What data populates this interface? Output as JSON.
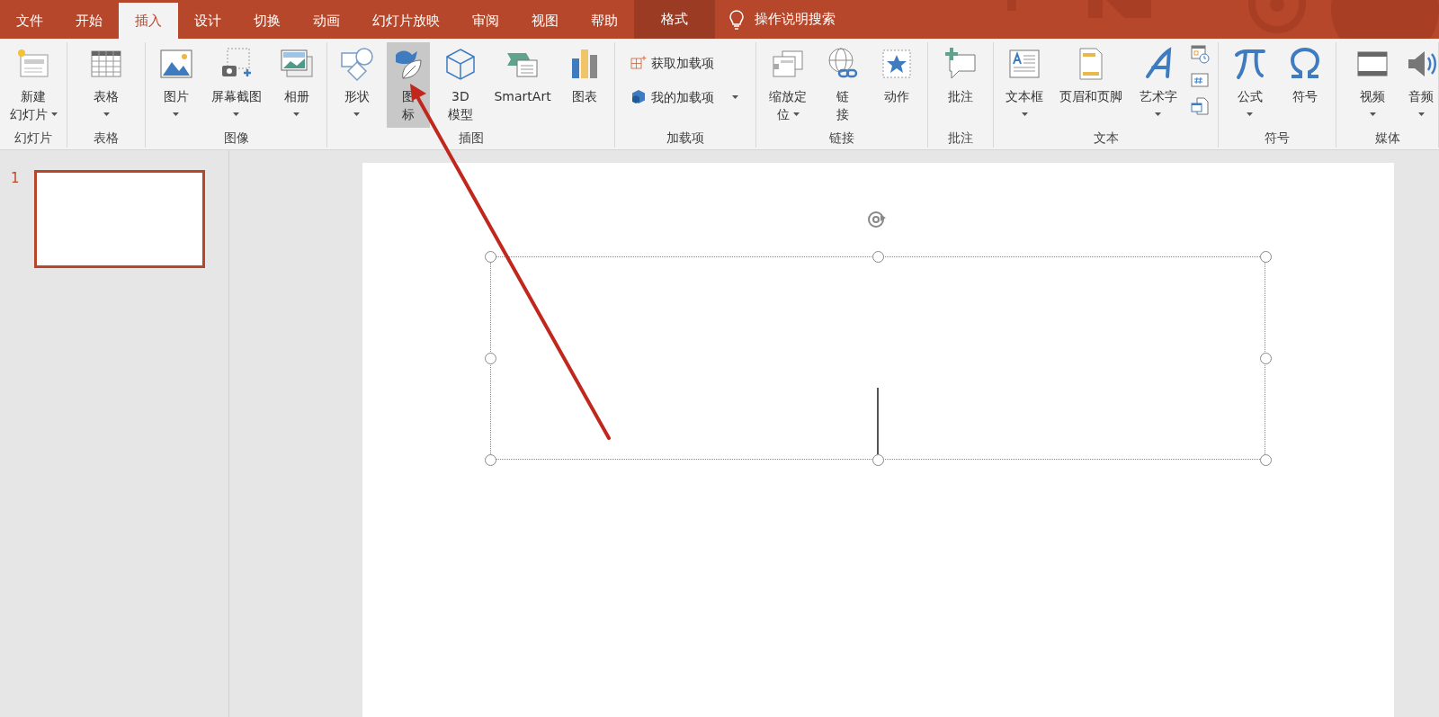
{
  "tabs": [
    {
      "label": "文件",
      "selected": false,
      "contextual": false
    },
    {
      "label": "开始",
      "selected": false,
      "contextual": false
    },
    {
      "label": "插入",
      "selected": true,
      "contextual": false
    },
    {
      "label": "设计",
      "selected": false,
      "contextual": false
    },
    {
      "label": "切换",
      "selected": false,
      "contextual": false
    },
    {
      "label": "动画",
      "selected": false,
      "contextual": false
    },
    {
      "label": "幻灯片放映",
      "selected": false,
      "contextual": false
    },
    {
      "label": "审阅",
      "selected": false,
      "contextual": false
    },
    {
      "label": "视图",
      "selected": false,
      "contextual": false
    },
    {
      "label": "帮助",
      "selected": false,
      "contextual": false
    },
    {
      "label": "格式",
      "selected": false,
      "contextual": true
    }
  ],
  "search": {
    "label": "操作说明搜索"
  },
  "groups": [
    {
      "label": "幻灯片",
      "items": [
        {
          "kind": "large",
          "lines": [
            "新建",
            "幻灯片"
          ],
          "dropdown": true,
          "hovered": false
        }
      ]
    },
    {
      "label": "表格",
      "items": [
        {
          "kind": "large",
          "lines": [
            "表格"
          ],
          "dropdown": true,
          "hovered": false
        }
      ]
    },
    {
      "label": "图像",
      "items": [
        {
          "kind": "large",
          "lines": [
            "图片"
          ],
          "dropdown": true,
          "hovered": false
        },
        {
          "kind": "large",
          "lines": [
            "屏幕截图"
          ],
          "dropdown": true,
          "hovered": false
        },
        {
          "kind": "large",
          "lines": [
            "相册"
          ],
          "dropdown": true,
          "hovered": false
        }
      ]
    },
    {
      "label": "插图",
      "items": [
        {
          "kind": "large",
          "lines": [
            "形状"
          ],
          "dropdown": true,
          "hovered": false
        },
        {
          "kind": "large",
          "lines": [
            "图",
            "标"
          ],
          "dropdown": false,
          "hovered": true
        },
        {
          "kind": "large",
          "lines": [
            "3D",
            "模型"
          ],
          "dropdown": false,
          "hovered": false
        },
        {
          "kind": "large",
          "lines": [
            "SmartArt"
          ],
          "dropdown": false,
          "hovered": false
        },
        {
          "kind": "large",
          "lines": [
            "图表"
          ],
          "dropdown": false,
          "hovered": false
        }
      ]
    },
    {
      "label": "加载项",
      "items": [
        {
          "kind": "small",
          "lines": [
            "获取加载项"
          ],
          "dropdown": false,
          "hovered": false
        },
        {
          "kind": "small",
          "lines": [
            "我的加载项"
          ],
          "dropdown": true,
          "hovered": false
        }
      ]
    },
    {
      "label": "链接",
      "items": [
        {
          "kind": "large",
          "lines": [
            "缩放定",
            "位"
          ],
          "dropdown": true,
          "hovered": false
        },
        {
          "kind": "large",
          "lines": [
            "链",
            "接"
          ],
          "dropdown": false,
          "hovered": false
        },
        {
          "kind": "large",
          "lines": [
            "动作"
          ],
          "dropdown": false,
          "hovered": false
        }
      ]
    },
    {
      "label": "批注",
      "items": [
        {
          "kind": "large",
          "lines": [
            "批注"
          ],
          "dropdown": false,
          "hovered": false
        }
      ]
    },
    {
      "label": "文本",
      "items": [
        {
          "kind": "large",
          "lines": [
            "文本框"
          ],
          "dropdown": true,
          "hovered": false
        },
        {
          "kind": "large",
          "lines": [
            "页眉和页脚"
          ],
          "dropdown": false,
          "hovered": false
        },
        {
          "kind": "large",
          "lines": [
            "艺术字"
          ],
          "dropdown": true,
          "hovered": false
        },
        {
          "kind": "icon-column"
        }
      ]
    },
    {
      "label": "符号",
      "items": [
        {
          "kind": "large",
          "lines": [
            "公式"
          ],
          "dropdown": true,
          "hovered": false
        },
        {
          "kind": "large",
          "lines": [
            "符号"
          ],
          "dropdown": false,
          "hovered": false
        }
      ]
    },
    {
      "label": "媒体",
      "items": [
        {
          "kind": "large",
          "lines": [
            "视频"
          ],
          "dropdown": true,
          "hovered": false
        },
        {
          "kind": "large",
          "lines": [
            "音频"
          ],
          "dropdown": true,
          "hovered": false
        }
      ]
    }
  ],
  "slides": [
    {
      "number": "1",
      "selected": true
    }
  ]
}
